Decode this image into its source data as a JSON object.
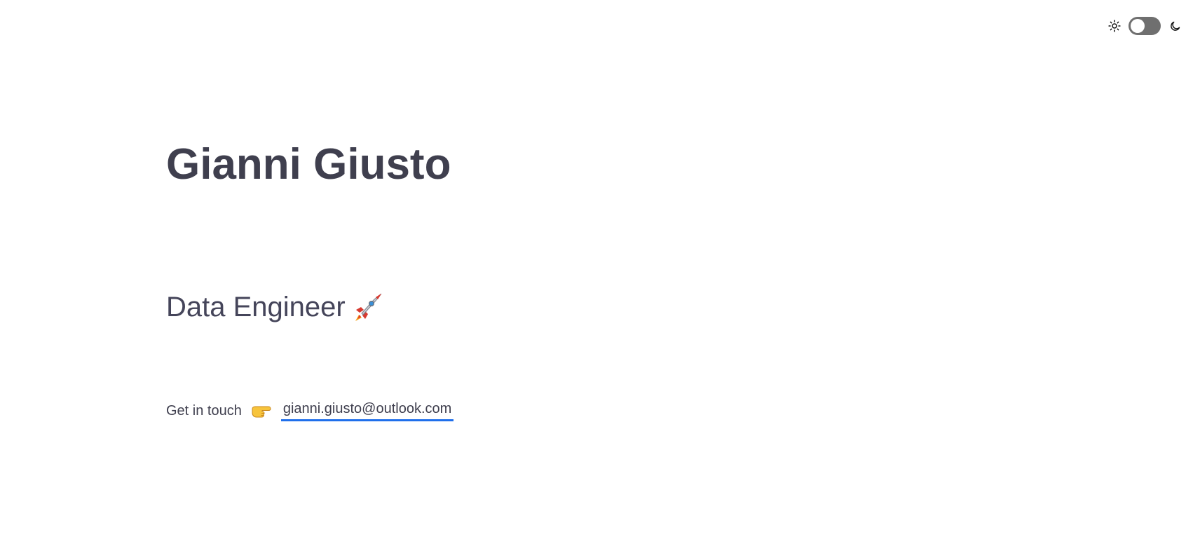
{
  "theme_toggle": {
    "light_icon": "sun-icon",
    "dark_icon": "moon-icon",
    "state": "light",
    "track_color": "#6f6f6f"
  },
  "hero": {
    "name": "Gianni Giusto",
    "role": "Data Engineer",
    "role_icon": "rocket-icon",
    "contact_label": "Get in touch",
    "contact_icon": "pointing-hand-icon",
    "email": "gianni.giusto@outlook.com"
  },
  "colors": {
    "text": "#3f3f4e",
    "link_underline": "#1f6feb",
    "background": "#ffffff"
  }
}
